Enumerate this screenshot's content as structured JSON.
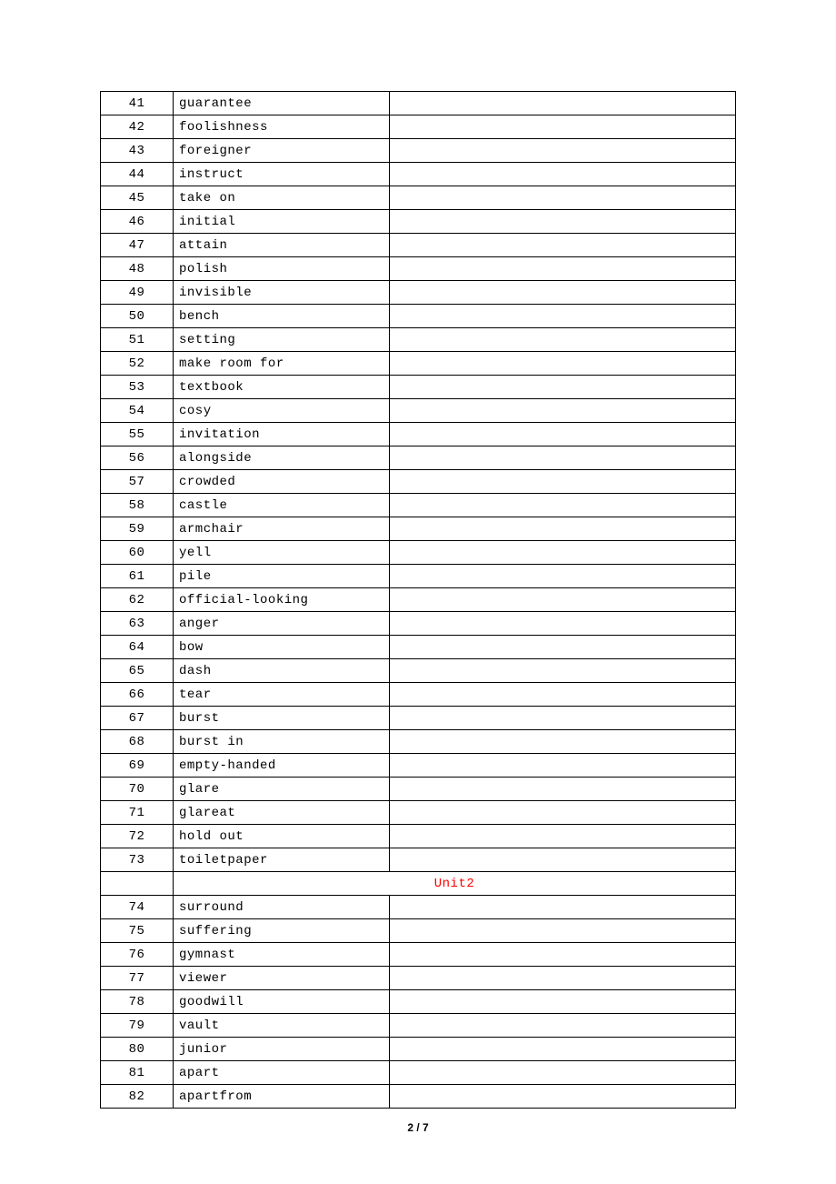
{
  "rows": [
    {
      "num": "41",
      "word": "guarantee"
    },
    {
      "num": "42",
      "word": "foolishness"
    },
    {
      "num": "43",
      "word": "foreigner"
    },
    {
      "num": "44",
      "word": "instruct"
    },
    {
      "num": "45",
      "word": "take on"
    },
    {
      "num": "46",
      "word": "initial"
    },
    {
      "num": "47",
      "word": "attain"
    },
    {
      "num": "48",
      "word": "polish"
    },
    {
      "num": "49",
      "word": "invisible"
    },
    {
      "num": "50",
      "word": "bench"
    },
    {
      "num": "51",
      "word": "setting"
    },
    {
      "num": "52",
      "word": "make room for"
    },
    {
      "num": "53",
      "word": "textbook"
    },
    {
      "num": "54",
      "word": "cosy"
    },
    {
      "num": "55",
      "word": "invitation"
    },
    {
      "num": "56",
      "word": "alongside"
    },
    {
      "num": "57",
      "word": "crowded"
    },
    {
      "num": "58",
      "word": "castle"
    },
    {
      "num": "59",
      "word": "armchair"
    },
    {
      "num": "60",
      "word": "yell"
    },
    {
      "num": "61",
      "word": "pile"
    },
    {
      "num": "62",
      "word": "official-looking"
    },
    {
      "num": "63",
      "word": "anger"
    },
    {
      "num": "64",
      "word": "bow"
    },
    {
      "num": "65",
      "word": "dash"
    },
    {
      "num": "66",
      "word": "tear"
    },
    {
      "num": "67",
      "word": "burst"
    },
    {
      "num": "68",
      "word": "burst in"
    },
    {
      "num": "69",
      "word": "empty-handed"
    },
    {
      "num": "70",
      "word": "glare"
    },
    {
      "num": "71",
      "word": "glareat"
    },
    {
      "num": "72",
      "word": "hold out"
    },
    {
      "num": "73",
      "word": "toiletpaper"
    },
    {
      "type": "unit",
      "label": "Unit2"
    },
    {
      "num": "74",
      "word": "surround"
    },
    {
      "num": "75",
      "word": "suffering"
    },
    {
      "num": "76",
      "word": "gymnast"
    },
    {
      "num": "77",
      "word": "viewer"
    },
    {
      "num": "78",
      "word": "goodwill"
    },
    {
      "num": "79",
      "word": "vault"
    },
    {
      "num": "80",
      "word": "junior"
    },
    {
      "num": "81",
      "word": "apart"
    },
    {
      "num": "82",
      "word": "apartfrom"
    }
  ],
  "footer": "2 / 7"
}
